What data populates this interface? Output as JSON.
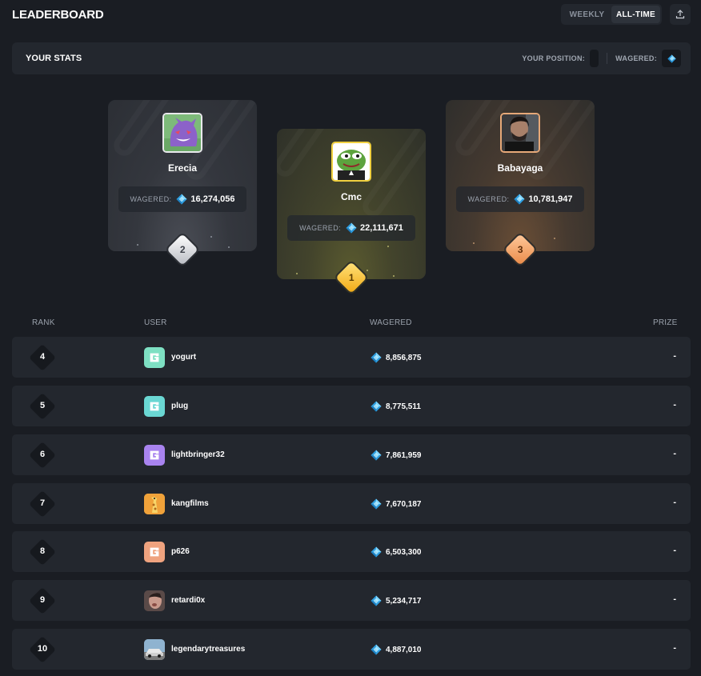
{
  "header": {
    "title": "LEADERBOARD",
    "tabs": [
      {
        "label": "WEEKLY",
        "active": false
      },
      {
        "label": "ALL-TIME",
        "active": true
      }
    ],
    "share_icon": "upload-icon"
  },
  "stats": {
    "title": "YOUR STATS",
    "position_label": "YOUR POSITION:",
    "wagered_label": "WAGERED:"
  },
  "podium": {
    "wagered_label": "WAGERED:",
    "first": {
      "rank": "1",
      "name": "Cmc",
      "wagered": "22,111,671"
    },
    "second": {
      "rank": "2",
      "name": "Erecia",
      "wagered": "16,274,056"
    },
    "third": {
      "rank": "3",
      "name": "Babayaga",
      "wagered": "10,781,947"
    }
  },
  "table": {
    "columns": {
      "rank": "RANK",
      "user": "USER",
      "wagered": "WAGERED",
      "prize": "PRIZE"
    },
    "rows": [
      {
        "rank": "4",
        "user": "yogurt",
        "wagered": "8,856,875",
        "prize": "-"
      },
      {
        "rank": "5",
        "user": "plug",
        "wagered": "8,775,511",
        "prize": "-"
      },
      {
        "rank": "6",
        "user": "lightbringer32",
        "wagered": "7,861,959",
        "prize": "-"
      },
      {
        "rank": "7",
        "user": "kangfilms",
        "wagered": "7,670,187",
        "prize": "-"
      },
      {
        "rank": "8",
        "user": "p626",
        "wagered": "6,503,300",
        "prize": "-"
      },
      {
        "rank": "9",
        "user": "retardi0x",
        "wagered": "5,234,717",
        "prize": "-"
      },
      {
        "rank": "10",
        "user": "legendarytreasures",
        "wagered": "4,887,010",
        "prize": "-"
      }
    ]
  },
  "colors": {
    "background": "#1a1d23",
    "panel": "#23272e",
    "gem": "#3fb8f2",
    "gold": "#f1c232",
    "silver": "#d8dade",
    "bronze": "#f0a06a"
  }
}
